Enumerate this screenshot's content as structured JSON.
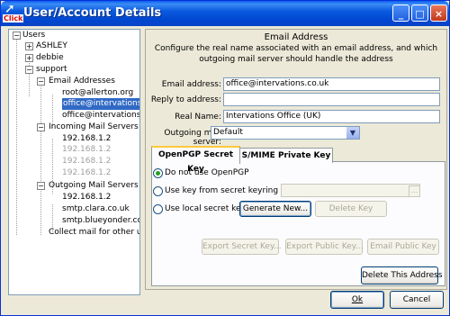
{
  "window": {
    "title": "User/Account Details",
    "icon_caption": "Click",
    "minimize_label": "_",
    "maximize_label": "□",
    "close_label": "×"
  },
  "tree": {
    "root": "Users",
    "users": [
      "ASHLEY",
      "debbie",
      "support"
    ],
    "email_group": "Email Addresses",
    "emails": [
      "root@allerton.org",
      "office@intervations",
      "office@intervations"
    ],
    "incoming_group": "Incoming Mail Servers",
    "incoming": [
      "192.168.1.2",
      "192.168.1.2",
      "192.168.1.2",
      "192.168.1.2"
    ],
    "outgoing_group": "Outgoing Mail Servers (S",
    "outgoing": [
      "192.168.1.2",
      "smtp.clara.co.uk",
      "smtp.blueyonder.co"
    ],
    "collect": "Collect mail for other use",
    "expand_symbol": "+",
    "collapse_symbol": "−"
  },
  "panel": {
    "title": "Email Address",
    "description": "Configure the real name associated with an email address, and which outgoing mail server should handle the address",
    "fields": {
      "email_label": "Email address:",
      "email_value": "office@intervations.co.uk",
      "reply_label": "Reply to address:",
      "reply_value": "",
      "name_label": "Real Name:",
      "name_value": "Intervations Office (UK)",
      "server_label": "Outgoing mail server:",
      "server_value": "Default",
      "dropdown_arrow": "▼"
    },
    "tabs": [
      "OpenPGP Secret Key",
      "S/MIME Private Key"
    ],
    "options": {
      "none": "Do not use OpenPGP",
      "keyring": "Use key from secret keyring file:",
      "local": "Use local secret key:",
      "browse": "..."
    },
    "buttons": {
      "generate": "Generate New...",
      "delete_key": "Delete Key",
      "export_secret": "Export Secret Key...",
      "export_public": "Export Public Key...",
      "email_public": "Email Public Key"
    }
  },
  "footer": {
    "delete_address": "Delete This Address",
    "ok": "Ok",
    "cancel": "Cancel"
  }
}
